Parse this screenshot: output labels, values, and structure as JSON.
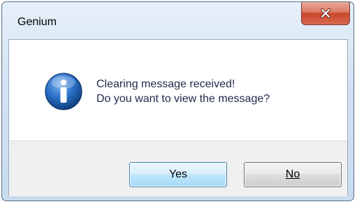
{
  "window": {
    "title": "Genium",
    "close_icon": "close-icon"
  },
  "dialog": {
    "icon": "information-icon",
    "message_lines": [
      "Clearing message received!",
      "Do you want to view the message?"
    ]
  },
  "buttons": {
    "yes_label": "Yes",
    "no_label": "No"
  },
  "colors": {
    "close_button": "#c7472b",
    "info_icon": "#1f5fb4",
    "default_button_border": "#3c7fb1"
  }
}
